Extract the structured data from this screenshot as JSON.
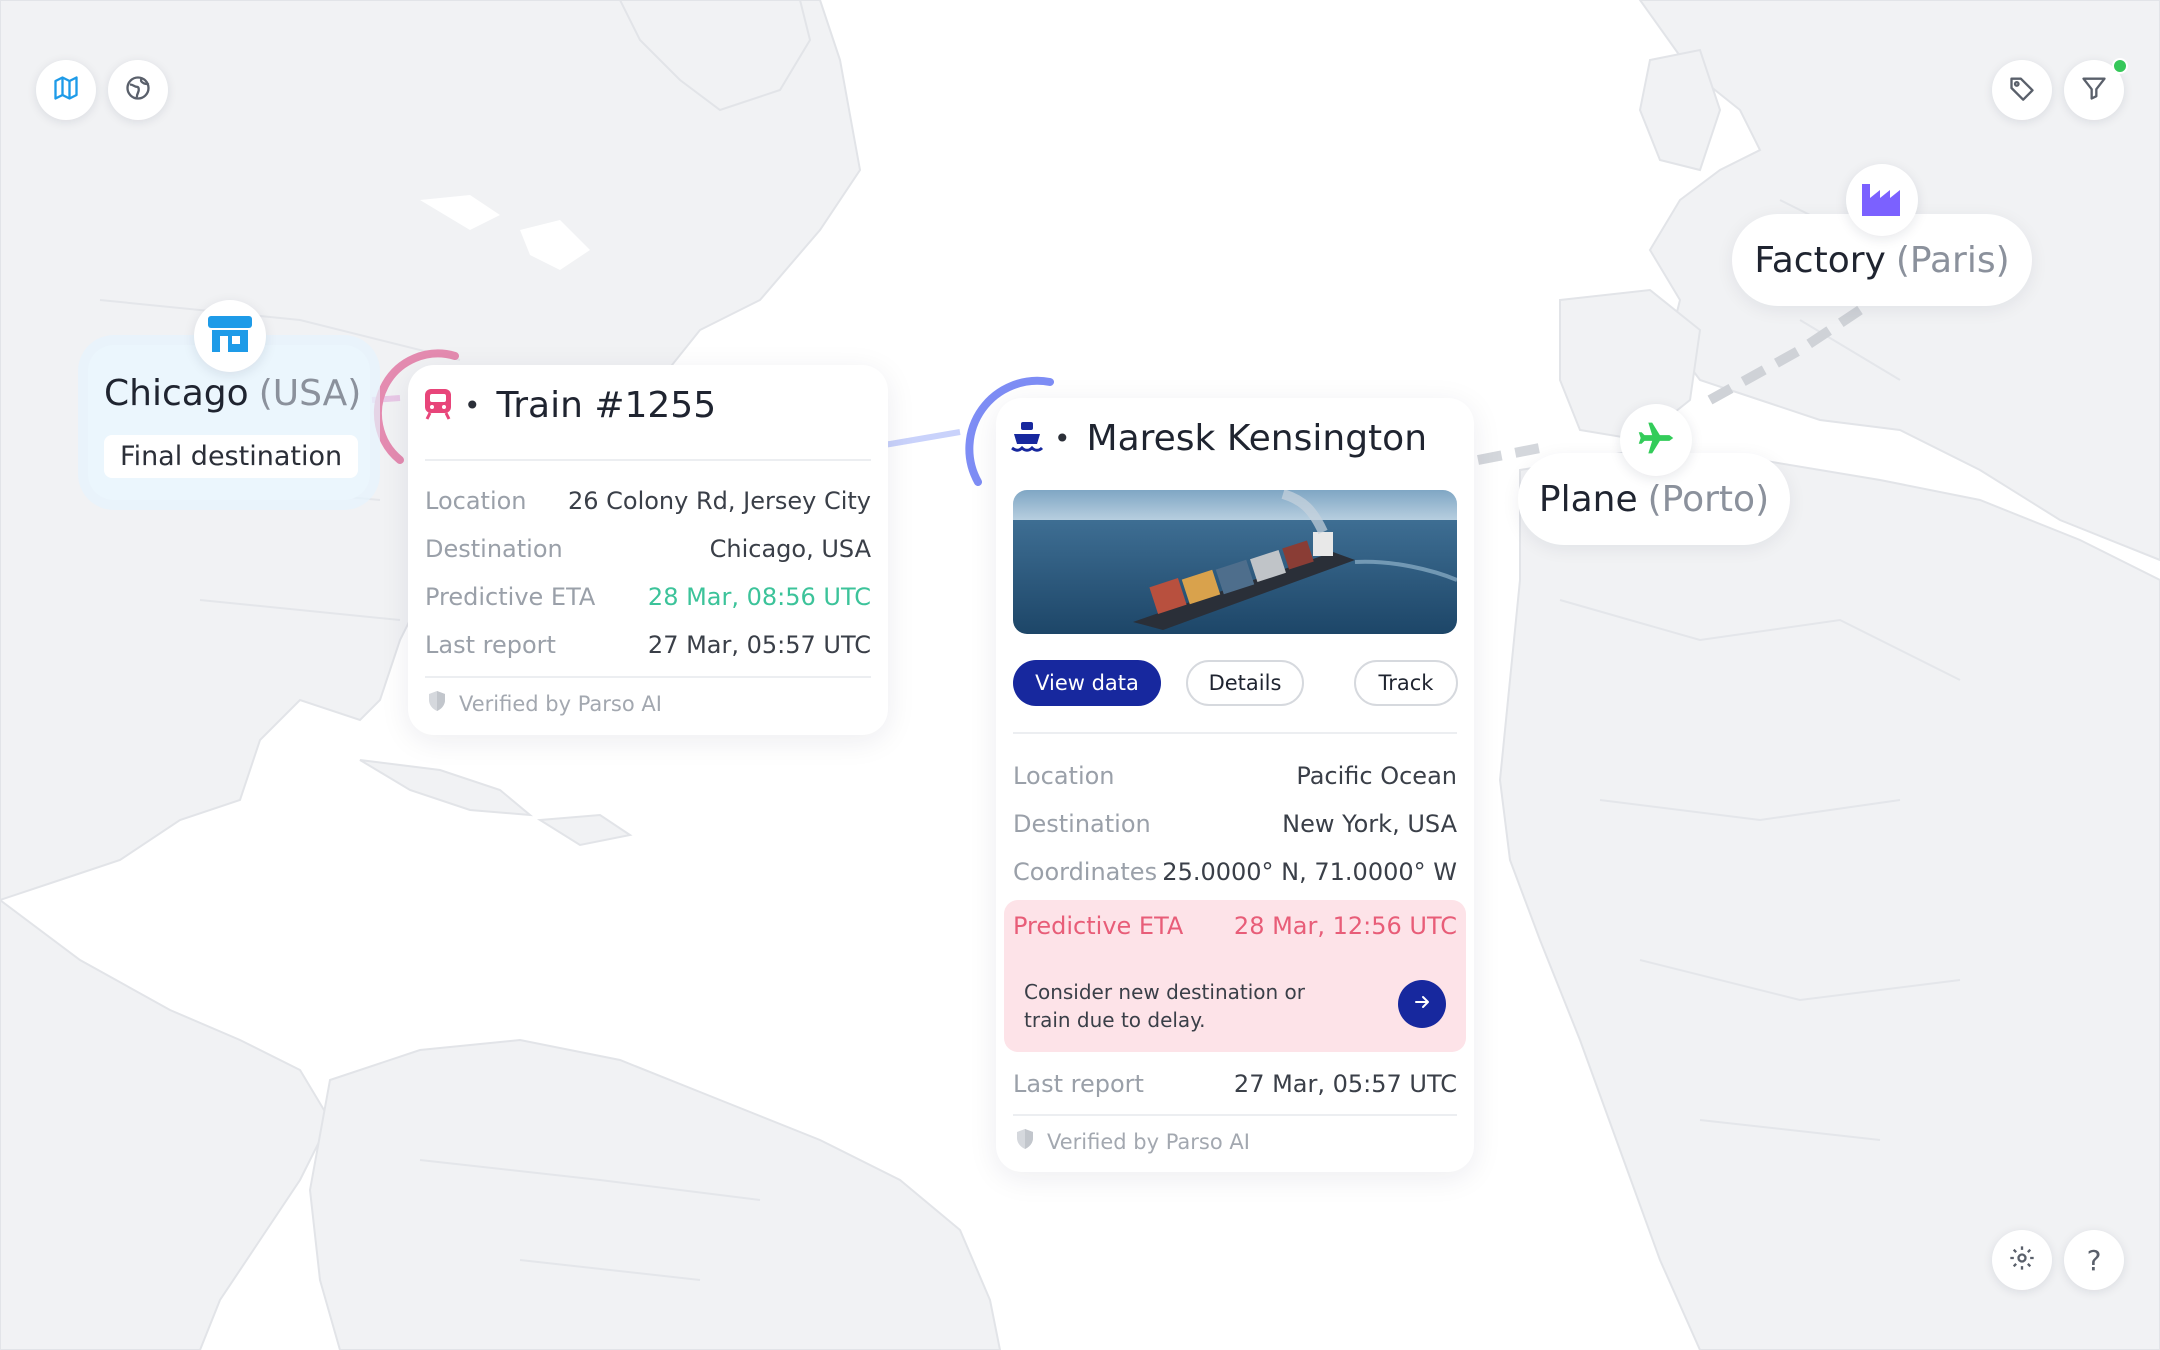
{
  "toolbar": {
    "map_view_icon": "map-icon",
    "globe_view_icon": "globe-icon",
    "tag_icon": "tag-icon",
    "filter_icon": "filter-icon",
    "settings_icon": "gear-icon",
    "help_icon": "question-icon",
    "help_glyph": "?"
  },
  "places": {
    "chicago": {
      "name": "Chicago",
      "region": "(USA)",
      "tag": "Final destination",
      "icon": "store-icon"
    },
    "factory": {
      "name": "Factory",
      "region": "(Paris)",
      "icon": "factory-icon"
    },
    "plane": {
      "name": "Plane",
      "region": "(Porto)",
      "icon": "plane-icon"
    }
  },
  "train_card": {
    "icon": "train-icon",
    "separator": "•",
    "title": "Train #1255",
    "rows": [
      {
        "label": "Location",
        "value": "26 Colony Rd, Jersey City"
      },
      {
        "label": "Destination",
        "value": "Chicago, USA"
      },
      {
        "label": "Predictive ETA",
        "value": "28 Mar, 08:56 UTC"
      },
      {
        "label": "Last report",
        "value": "27 Mar, 05:57 UTC"
      }
    ],
    "verified": "Verified by Parso AI"
  },
  "ship_card": {
    "icon": "ship-icon",
    "separator": "•",
    "title": "Maresk Kensington",
    "buttons": {
      "view_data": "View data",
      "details": "Details",
      "track": "Track"
    },
    "rows": [
      {
        "label": "Location",
        "value": "Pacific Ocean"
      },
      {
        "label": "Destination",
        "value": "New York, USA"
      },
      {
        "label": "Coordinates",
        "value": "25.0000° N, 71.0000° W"
      }
    ],
    "alert": {
      "label": "Predictive ETA",
      "value": "28 Mar, 12:56 UTC",
      "message": "Consider new destination or train due to delay."
    },
    "last_report": {
      "label": "Last report",
      "value": "27 Mar, 05:57 UTC"
    },
    "verified": "Verified by Parso AI"
  },
  "colors": {
    "accent_navy": "#17289e",
    "train_pink": "#e8457a",
    "chicago_blue": "#1e9be8",
    "factory_purple": "#7b61ff",
    "plane_green": "#33cc5a",
    "eta_green": "#3cc39a",
    "alert_red": "#e85d78",
    "status_dot": "#35c759"
  }
}
